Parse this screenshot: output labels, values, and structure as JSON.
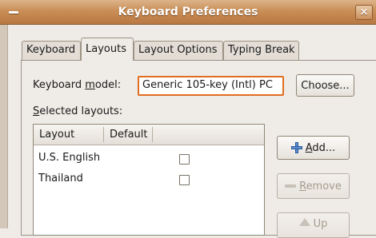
{
  "window": {
    "title": "Keyboard Preferences",
    "close_glyph": "×"
  },
  "tabs": [
    {
      "label": "Keyboard",
      "active": false
    },
    {
      "label": "Layouts",
      "active": true
    },
    {
      "label": "Layout Options",
      "active": false
    },
    {
      "label": "Typing Break",
      "active": false
    }
  ],
  "layouts": {
    "model_label_pre": "Keyboard ",
    "model_label_mnemonic": "m",
    "model_label_post": "odel:",
    "model_value": "Generic 105-key (Intl) PC",
    "choose_button": "Choose...",
    "selected_label_mnemonic": "S",
    "selected_label_post": "elected layouts:",
    "columns": [
      "Layout",
      "Default"
    ],
    "rows": [
      {
        "layout": "U.S. English",
        "default": false
      },
      {
        "layout": "Thailand",
        "default": false
      }
    ],
    "add_button_mnemonic": "A",
    "add_button_post": "dd...",
    "remove_button_mnemonic": "R",
    "remove_button_post": "emove",
    "up_button": "Up"
  },
  "icons": {
    "menu": "window-menu-icon",
    "close": "close-icon",
    "add": "plus-icon",
    "remove": "minus-icon",
    "up": "up-arrow-icon"
  },
  "colors": {
    "titlebar": "#c98e56",
    "focus_border": "#e06e21",
    "window_bg": "#efebe7"
  }
}
